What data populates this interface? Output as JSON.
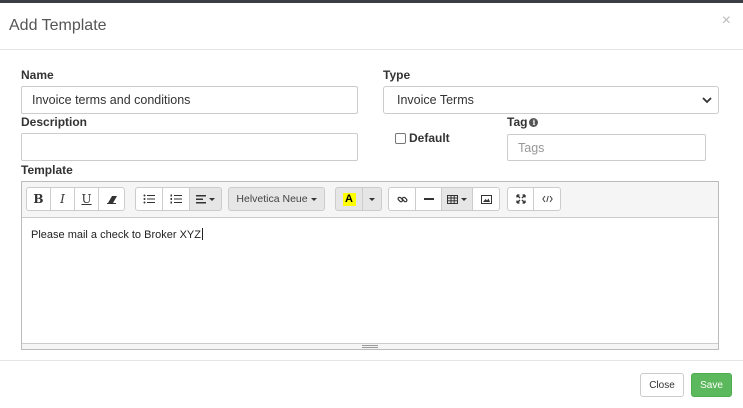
{
  "modal": {
    "title": "Add Template",
    "close_glyph": "×"
  },
  "form": {
    "name_label": "Name",
    "name_value": "Invoice terms and conditions",
    "type_label": "Type",
    "type_value": "Invoice Terms",
    "description_label": "Description",
    "description_value": "",
    "default_label": "Default",
    "default_checked": false,
    "tag_label": "Tag",
    "tag_placeholder": "Tags",
    "template_label": "Template"
  },
  "toolbar": {
    "bold": "B",
    "italic": "I",
    "underline": "U",
    "font_name": "Helvetica Neue",
    "highlight_letter": "A",
    "highlight_color": "#ffff00",
    "icons": [
      "bold-icon",
      "italic-icon",
      "underline-icon",
      "eraser-icon",
      "unordered-list-icon",
      "ordered-list-icon",
      "paragraph-align-icon",
      "font-name-dropdown",
      "highlight-color-icon",
      "link-icon",
      "horizontal-rule-icon",
      "table-icon",
      "picture-icon",
      "fullscreen-icon",
      "code-view-icon"
    ]
  },
  "editor": {
    "content": "Please mail a check to Broker XYZ"
  },
  "footer": {
    "close_label": "Close",
    "save_label": "Save",
    "save_color": "#5cb85c"
  }
}
